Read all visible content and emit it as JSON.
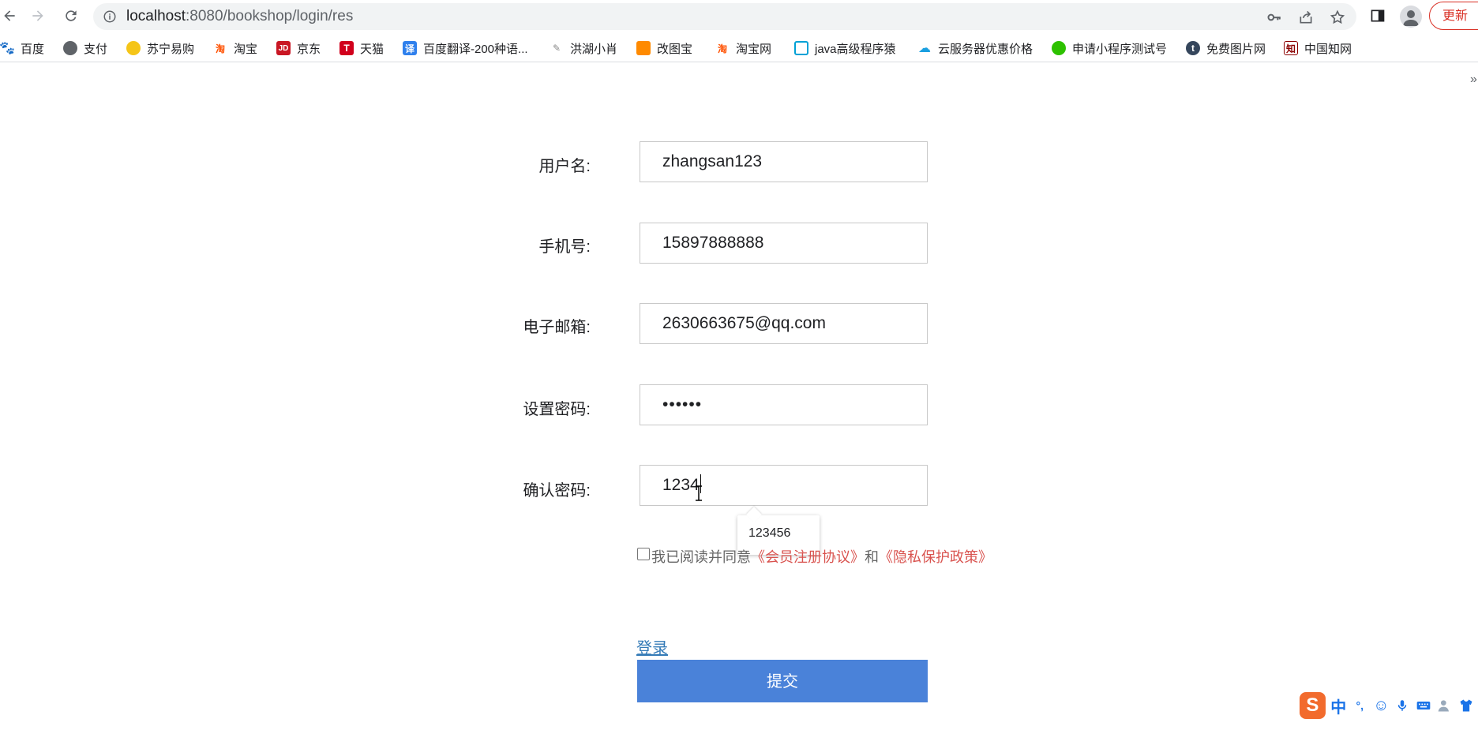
{
  "browser": {
    "url_host": "localhost",
    "url_path": ":8080/bookshop/login/res",
    "update_label": "更新"
  },
  "bookmarks": [
    {
      "label": "百度",
      "icon": "baidu-paw-icon"
    },
    {
      "label": "支付",
      "icon": "globe-icon"
    },
    {
      "label": "苏宁易购",
      "icon": "suning-lion-icon"
    },
    {
      "label": "淘宝",
      "icon": "taobao-icon"
    },
    {
      "label": "京东",
      "icon": "jd-icon"
    },
    {
      "label": "天猫",
      "icon": "tmall-icon"
    },
    {
      "label": "百度翻译-200种语...",
      "icon": "translate-icon"
    },
    {
      "label": "洪湖小肖",
      "icon": "feather-icon"
    },
    {
      "label": "改图宝",
      "icon": "gaitubao-icon"
    },
    {
      "label": "淘宝网",
      "icon": "taobao-icon"
    },
    {
      "label": "java高级程序猿",
      "icon": "bilibili-icon"
    },
    {
      "label": "云服务器优惠价格",
      "icon": "cloud-icon"
    },
    {
      "label": "申请小程序测试号",
      "icon": "wechat-icon"
    },
    {
      "label": "免费图片网",
      "icon": "tumblr-icon"
    },
    {
      "label": "中国知网",
      "icon": "cnki-icon"
    }
  ],
  "form": {
    "username_label": "用户名:",
    "username_value": "zhangsan123",
    "phone_label": "手机号:",
    "phone_value": "15897888888",
    "email_label": "电子邮箱:",
    "email_value": "2630663675@qq.com",
    "password_label": "设置密码:",
    "password_masked": "••••••",
    "confirm_label": "确认密码:",
    "confirm_value": "1234",
    "autocomplete_option": "123456",
    "agree_prefix": "我已阅读并同意",
    "agree_link1": "《会员注册协议》",
    "agree_and": "和",
    "agree_link2": "《隐私保护政策》",
    "login_link": "登录",
    "submit_label": "提交"
  },
  "ime": {
    "mode": "中",
    "punct": "°,"
  },
  "colors": {
    "submit_bg": "#4a82d9",
    "link_red": "#d9534f",
    "login_blue": "#337ab7"
  }
}
